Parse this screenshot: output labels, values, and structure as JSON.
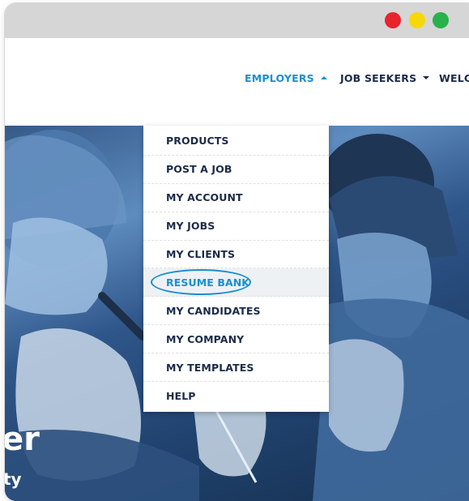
{
  "window": {
    "controls": [
      "close",
      "minimize",
      "maximize"
    ],
    "colors": {
      "close": "#e8232c",
      "minimize": "#f5d80a",
      "maximize": "#29b14b"
    }
  },
  "nav": {
    "employers": "EMPLOYERS",
    "job_seekers": "JOB SEEKERS",
    "welcome": "WELC"
  },
  "dropdown": {
    "items": [
      {
        "label": "PRODUCTS"
      },
      {
        "label": "POST A JOB"
      },
      {
        "label": "MY ACCOUNT"
      },
      {
        "label": "MY JOBS"
      },
      {
        "label": "MY CLIENTS"
      },
      {
        "label": "RESUME BANK",
        "highlighted": true
      },
      {
        "label": "MY CANDIDATES"
      },
      {
        "label": "MY COMPANY"
      },
      {
        "label": "MY TEMPLATES"
      },
      {
        "label": "HELP"
      }
    ]
  },
  "hero": {
    "headline_fragment": "er",
    "subline_fragment": "ty"
  },
  "colors": {
    "accent": "#1a8fcf",
    "nav_text": "#1b2b48",
    "titlebar": "#d6d6d6"
  }
}
